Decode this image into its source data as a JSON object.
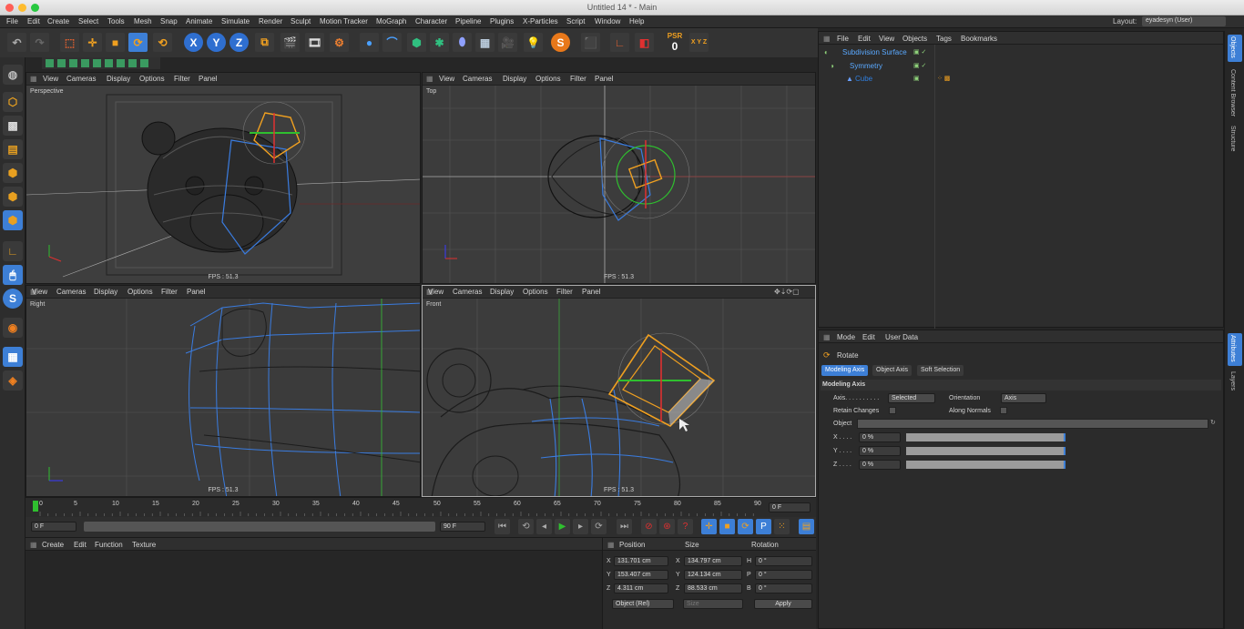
{
  "window": {
    "title": "Untitled 14 * - Main"
  },
  "menu": [
    "File",
    "Edit",
    "Create",
    "Select",
    "Tools",
    "Mesh",
    "Snap",
    "Animate",
    "Simulate",
    "Render",
    "Sculpt",
    "Motion Tracker",
    "MoGraph",
    "Character",
    "Pipeline",
    "Plugins",
    "X-Particles",
    "Script",
    "Window",
    "Help"
  ],
  "layout": {
    "label": "Layout:",
    "value": "eyadesyn (User)"
  },
  "toolbar": {
    "psr_label": "PSR",
    "psr_value": "0",
    "xyz_label": "X Y Z"
  },
  "viewports": {
    "menu": [
      "View",
      "Cameras",
      "Display",
      "Options",
      "Filter",
      "Panel"
    ],
    "perspective": {
      "name": "Perspective",
      "fps": "FPS : 51.3"
    },
    "top": {
      "name": "Top",
      "fps": "FPS : 51.3"
    },
    "right": {
      "name": "Right",
      "fps": "FPS : 51.3"
    },
    "front": {
      "name": "Front",
      "fps": "FPS : 51.3"
    }
  },
  "timeline": {
    "ticks": [
      "0",
      "5",
      "10",
      "15",
      "20",
      "25",
      "30",
      "35",
      "40",
      "45",
      "50",
      "55",
      "60",
      "65",
      "70",
      "75",
      "80",
      "85",
      "90"
    ],
    "current_frame": "0 F",
    "start_field": "0 F",
    "end_field": "90 F"
  },
  "material_panel": {
    "menu": [
      "Create",
      "Edit",
      "Function",
      "Texture"
    ]
  },
  "coordinates": {
    "headers": {
      "position": "Position",
      "size": "Size",
      "rotation": "Rotation"
    },
    "rows": [
      {
        "axis": "X",
        "pos": "131.701 cm",
        "size_axis": "X",
        "size": "134.797 cm",
        "rot_axis": "H",
        "rot": "0 °"
      },
      {
        "axis": "Y",
        "pos": "153.407 cm",
        "size_axis": "Y",
        "size": "124.134 cm",
        "rot_axis": "P",
        "rot": "0 °"
      },
      {
        "axis": "Z",
        "pos": "4.311 cm",
        "size_axis": "Z",
        "size": "88.533 cm",
        "rot_axis": "B",
        "rot": "0 °"
      }
    ],
    "mode": "Object (Rel)",
    "size_mode": "Size",
    "apply": "Apply"
  },
  "object_manager": {
    "menu": [
      "File",
      "Edit",
      "View",
      "Objects",
      "Tags",
      "Bookmarks"
    ],
    "objects": [
      {
        "name": "Subdivision Surface",
        "color": "#5aa9ff"
      },
      {
        "name": "Symmetry",
        "color": "#5aa9ff"
      },
      {
        "name": "Cube",
        "color": "#2f7fe0"
      }
    ]
  },
  "attribute_manager": {
    "menu": [
      "Mode",
      "Edit",
      "User Data"
    ],
    "tool": "Rotate",
    "tabs": [
      "Modeling Axis",
      "Object Axis",
      "Soft Selection"
    ],
    "section": "Modeling Axis",
    "axis_label": "Axis. . . . . . . . . .",
    "axis_value": "Selected",
    "orientation_label": "Orientation",
    "orientation_value": "Axis",
    "retain_changes": "Retain Changes",
    "along_normals": "Along Normals",
    "object_label": "Object",
    "xyz": [
      {
        "label": "X . . . .",
        "value": "0 %"
      },
      {
        "label": "Y . . . .",
        "value": "0 %"
      },
      {
        "label": "Z . . . .",
        "value": "0 %"
      }
    ]
  },
  "right_tabs": [
    "Objects",
    "Content Browser",
    "Structure",
    "Attributes",
    "Layers"
  ],
  "colors": {
    "accent": "#2f7fe0",
    "orange": "#e8a020",
    "selection_blue": "#3d7fd6"
  }
}
